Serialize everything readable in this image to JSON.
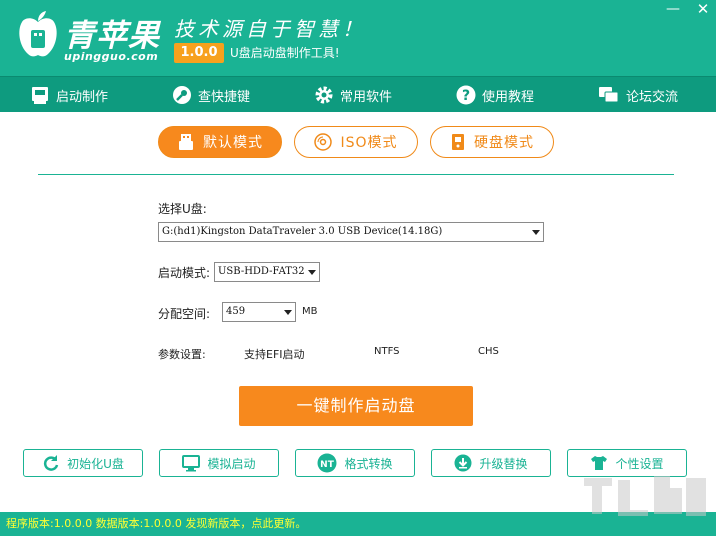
{
  "header": {
    "brand": "青苹果",
    "brand_url": "upingguo.com",
    "slogan": "技术源自于智慧！",
    "version_badge": "1.0.0",
    "subtitle": "U盘启动盘制作工具!",
    "minimize": "—",
    "close": "✕"
  },
  "nav": {
    "items": [
      {
        "label": "启动制作",
        "icon": "usb-drive-icon"
      },
      {
        "label": "查快捷键",
        "icon": "key-icon"
      },
      {
        "label": "常用软件",
        "icon": "gear-icon"
      },
      {
        "label": "使用教程",
        "icon": "help-icon"
      },
      {
        "label": "论坛交流",
        "icon": "chat-icon"
      }
    ]
  },
  "modes": {
    "default": "默认模式",
    "iso": "ISO模式",
    "hdd": "硬盘模式"
  },
  "form": {
    "usb_label": "选择U盘:",
    "usb_value": "G:(hd1)Kingston DataTraveler 3.0 USB Device(14.18G)",
    "boot_mode_label": "启动模式:",
    "boot_mode_value": "USB-HDD-FAT32",
    "alloc_label": "分配空间:",
    "alloc_value": "459",
    "alloc_unit": "MB",
    "params_label": "参数设置:",
    "param_efi": "支持EFI启动",
    "param_ntfs": "NTFS",
    "param_chs": "CHS"
  },
  "main_button": "一键制作启动盘",
  "tools": [
    {
      "label": "初始化U盘",
      "icon": "refresh-icon"
    },
    {
      "label": "模拟启动",
      "icon": "monitor-icon"
    },
    {
      "label": "格式转换",
      "icon": "nt-icon"
    },
    {
      "label": "升级替换",
      "icon": "download-icon"
    },
    {
      "label": "个性设置",
      "icon": "shirt-icon"
    }
  ],
  "status": "程序版本:1.0.0.0  数据版本:1.0.0.0 发现新版本，点此更新。",
  "colors": {
    "primary": "#1ab394",
    "nav": "#0e9b7f",
    "accent": "#f7891d",
    "status_text": "#ffff33"
  }
}
